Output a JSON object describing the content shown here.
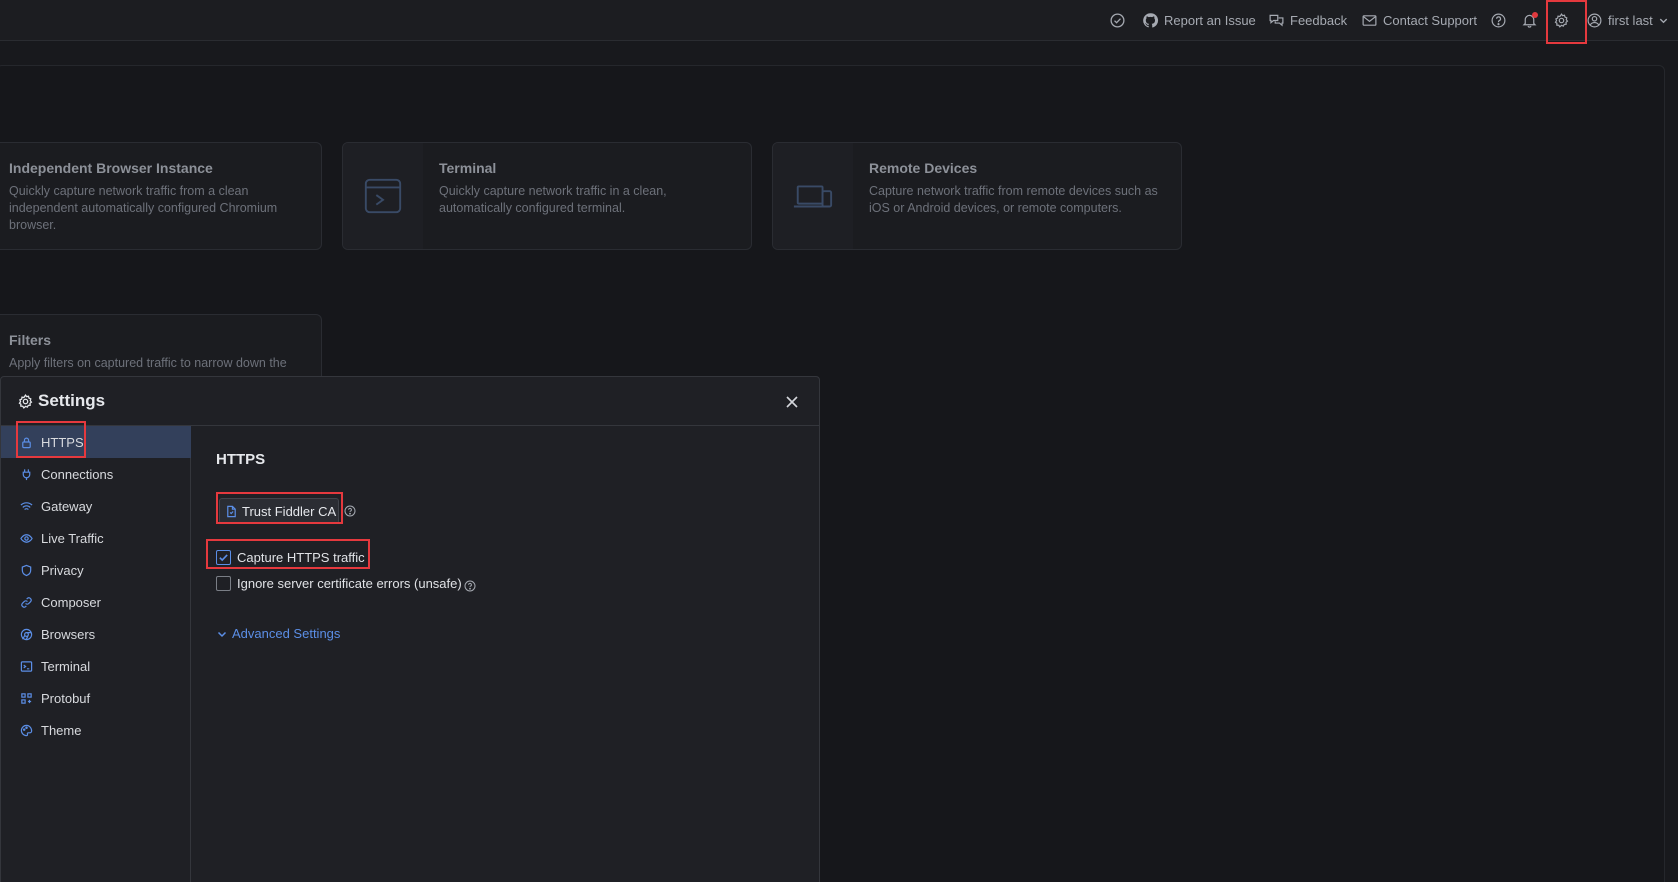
{
  "topbar": {
    "report_issue": "Report an Issue",
    "feedback": "Feedback",
    "contact_support": "Contact Support",
    "user_name": "first last"
  },
  "cards": [
    {
      "title": "Independent Browser Instance",
      "desc": "Quickly capture network traffic from a clean independent automatically configured Chromium browser."
    },
    {
      "title": "Terminal",
      "desc": "Quickly capture network traffic in a clean, automatically configured terminal."
    },
    {
      "title": "Remote Devices",
      "desc": "Capture network traffic from remote devices such as iOS or Android devices, or remote computers."
    },
    {
      "title": "Filters",
      "desc": "Apply filters on captured traffic to narrow down the"
    }
  ],
  "dialog": {
    "title": "Settings",
    "sidebar": [
      {
        "label": "HTTPS",
        "icon": "lock-icon"
      },
      {
        "label": "Connections",
        "icon": "plug-icon"
      },
      {
        "label": "Gateway",
        "icon": "wifi-icon"
      },
      {
        "label": "Live Traffic",
        "icon": "eye-icon"
      },
      {
        "label": "Privacy",
        "icon": "shield-icon"
      },
      {
        "label": "Composer",
        "icon": "link-icon"
      },
      {
        "label": "Browsers",
        "icon": "browser-icon"
      },
      {
        "label": "Terminal",
        "icon": "terminal-icon"
      },
      {
        "label": "Protobuf",
        "icon": "protobuf-icon"
      },
      {
        "label": "Theme",
        "icon": "palette-icon"
      }
    ],
    "active_item": "HTTPS",
    "content": {
      "section_title": "HTTPS",
      "trust_button": "Trust Fiddler CA",
      "capture_https": {
        "label": "Capture HTTPS traffic",
        "checked": true
      },
      "ignore_cert": {
        "label": "Ignore server certificate errors (unsafe)",
        "checked": false
      },
      "advanced_link": "Advanced Settings"
    }
  },
  "colors": {
    "accent": "#5b8ee6",
    "highlight": "#e5393e",
    "active_bg": "#33405b"
  }
}
